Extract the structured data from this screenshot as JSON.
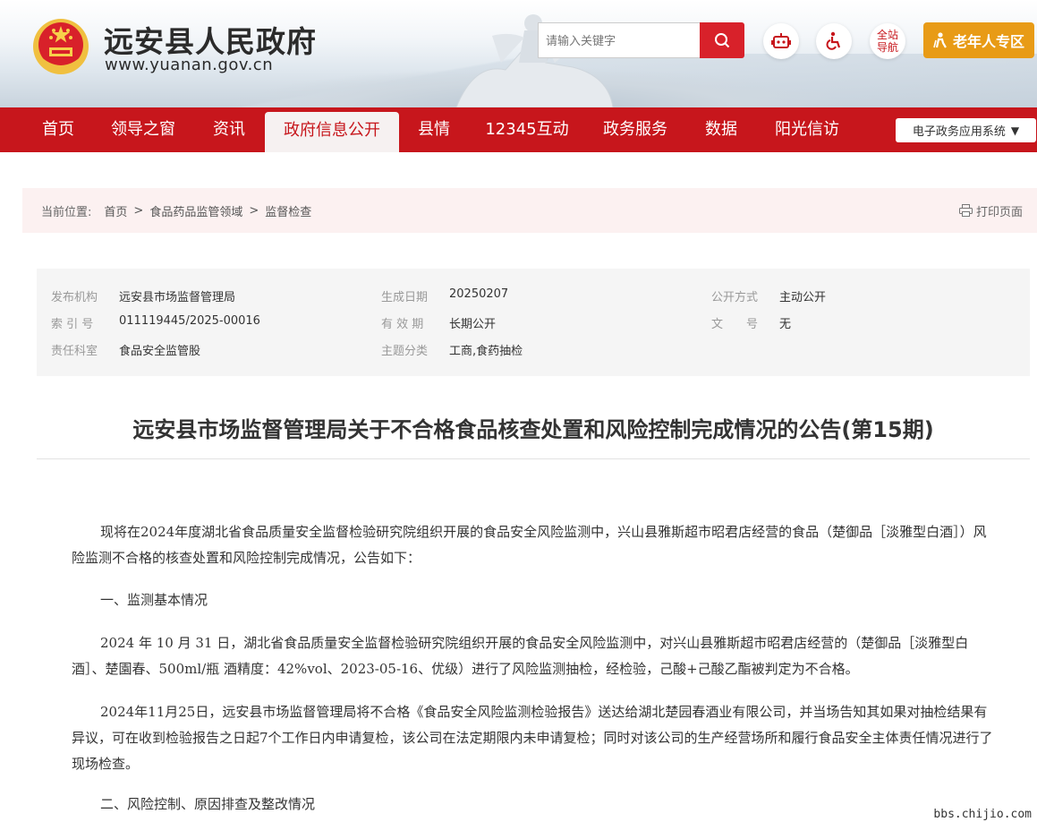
{
  "header": {
    "site_title": "远安县人民政府",
    "site_url": "www.yuanan.gov.cn",
    "search_placeholder": "请输入关键字",
    "sitenav_label_1": "全站",
    "sitenav_label_2": "导航",
    "elder_label": "老年人专区"
  },
  "nav": {
    "items": [
      "首页",
      "领导之窗",
      "资讯",
      "政府信息公开",
      "县情",
      "12345互动",
      "政务服务",
      "数据",
      "阳光信访"
    ],
    "active": "政府信息公开",
    "eapp_label": "电子政务应用系统"
  },
  "breadcrumb": {
    "prefix": "当前位置:",
    "items": [
      "首页",
      "食品药品监管领域",
      "监督检查"
    ],
    "sep": ">",
    "print_label": "打印页面"
  },
  "meta": {
    "publisher_k": "发布机构",
    "publisher_v": "远安县市场监督管理局",
    "date_k": "生成日期",
    "date_v": "20250207",
    "open_k": "公开方式",
    "open_v": "主动公开",
    "index_k": "索 引 号",
    "index_v": "011119445/2025-00016",
    "valid_k": "有 效 期",
    "valid_v": "长期公开",
    "docno_k": "文　　号",
    "docno_v": "无",
    "dept_k": "责任科室",
    "dept_v": "食品安全监管股",
    "topic_k": "主题分类",
    "topic_v": "工商,食药抽检"
  },
  "article": {
    "title": "远安县市场监督管理局关于不合格食品核查处置和风险控制完成情况的公告(第15期)",
    "p1": "现将在2024年度湖北省食品质量安全监督检验研究院组织开展的食品安全风险监测中，兴山县雅斯超市昭君店经营的食品（楚御品［淡雅型白酒］）风险监测不合格的核查处置和风险控制完成情况，公告如下：",
    "h1": "一、监测基本情况",
    "p2": "2024 年 10 月 31 日，湖北省食品质量安全监督检验研究院组织开展的食品安全风险监测中，对兴山县雅斯超市昭君店经营的（楚御品［淡雅型白酒］、楚園春、500ml/瓶 酒精度：42%vol、2023-05-16、优级）进行了风险监测抽检，经检验，己酸+己酸乙酯被判定为不合格。",
    "p3": "2024年11月25日，远安县市场监督管理局将不合格《食品安全风险监测检验报告》送达给湖北楚园春酒业有限公司，并当场告知其如果对抽检结果有异议，可在收到检验报告之日起7个工作日内申请复检，该公司在法定期限内未申请复检；同时对该公司的生产经营场所和履行食品安全主体责任情况进行了现场检查。",
    "h2": "二、风险控制、原因排查及整改情况"
  },
  "watermark": "bbs.chijio.com",
  "colors": {
    "brand_red": "#c7161c",
    "elder_orange": "#e89b16",
    "crumb_bg": "#fcf1f1"
  }
}
